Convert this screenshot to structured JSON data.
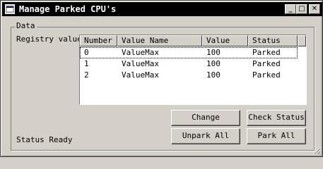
{
  "window": {
    "title": "Manage Parked CPU's",
    "minimize_glyph": "_",
    "maximize_glyph": "□",
    "close_glyph": "✕"
  },
  "group": {
    "label": "Data"
  },
  "registry_label": "Registry values",
  "table": {
    "columns": [
      "Number",
      "Value Name",
      "Value",
      "Status"
    ],
    "rows": [
      [
        "0",
        "ValueMax",
        "100",
        "Parked"
      ],
      [
        "1",
        "ValueMax",
        "100",
        "Parked"
      ],
      [
        "2",
        "ValueMax",
        "100",
        "Parked"
      ]
    ]
  },
  "buttons": {
    "change": "Change",
    "check_status": "Check Status",
    "unpark_all": "Unpark All",
    "park_all": "Park All"
  },
  "status_text": "Status Ready"
}
